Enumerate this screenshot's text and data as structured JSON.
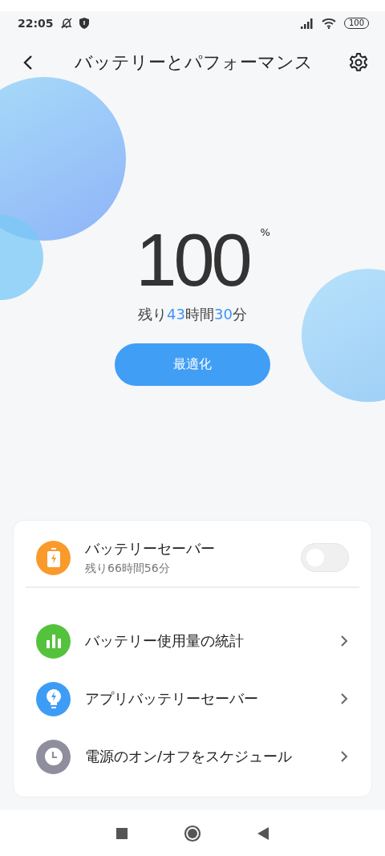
{
  "status_bar": {
    "time": "22:05",
    "battery": "100"
  },
  "header": {
    "title": "バッテリーとパフォーマンス"
  },
  "battery": {
    "percent": "100",
    "unit": "%",
    "remaining": [
      {
        "text": "残り",
        "highlight": false
      },
      {
        "text": "43",
        "highlight": true
      },
      {
        "text": "時間",
        "highlight": false
      },
      {
        "text": "30",
        "highlight": true
      },
      {
        "text": "分",
        "highlight": false
      }
    ],
    "button": "最適化"
  },
  "items": [
    {
      "kind": "toggle",
      "title": "バッテリーセーバー",
      "subtitle": "残り66時間56分",
      "color": "#f99a2b",
      "on": false
    },
    {
      "kind": "link",
      "title": "バッテリー使用量の統計",
      "color": "#55c23c"
    },
    {
      "kind": "link",
      "title": "アプリバッテリーセーバー",
      "color": "#3d9cf5"
    },
    {
      "kind": "link",
      "title": "電源のオン/オフをスケジュール",
      "color": "#8f8e9c"
    }
  ]
}
